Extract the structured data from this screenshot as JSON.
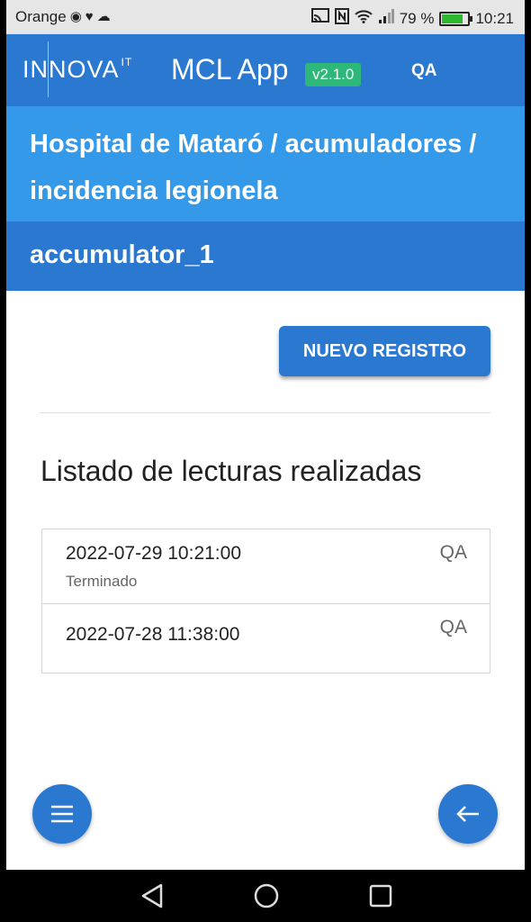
{
  "status_bar": {
    "carrier": "Orange",
    "battery": "79 %",
    "battery_level": 0.79,
    "time": "10:21",
    "icons": [
      "chrome-icon",
      "heart-icon",
      "cloud-icon",
      "cast-icon",
      "nfc-icon",
      "wifi-icon",
      "signal-icon",
      "battery-icon"
    ]
  },
  "app_bar": {
    "logo": "INNOVA",
    "logo_sup": "IT",
    "app_name": "MCL App",
    "version": "v2.1.0",
    "user": "QA"
  },
  "breadcrumb": {
    "text": "Hospital de Mataró / acumuladores / incidencia legionela"
  },
  "device": {
    "name": "accumulator_1"
  },
  "actions": {
    "new_record": "NUEVO REGISTRO"
  },
  "readings": {
    "title": "Listado de lecturas realizadas",
    "items": [
      {
        "datetime": "2022-07-29 10:21:00",
        "status": "Terminado",
        "user": "QA"
      },
      {
        "datetime": "2022-07-28 11:38:00",
        "status": "",
        "user": "QA"
      }
    ]
  },
  "colors": {
    "primary": "#2b78d0",
    "breadcrumb": "#3399e8",
    "version_badge": "#2db87a"
  },
  "fab": {
    "menu_icon": "hamburger-menu-icon",
    "back_icon": "arrow-left-icon"
  },
  "nav_bar": {
    "icons": [
      "back-triangle-icon",
      "home-circle-icon",
      "recents-square-icon"
    ]
  }
}
